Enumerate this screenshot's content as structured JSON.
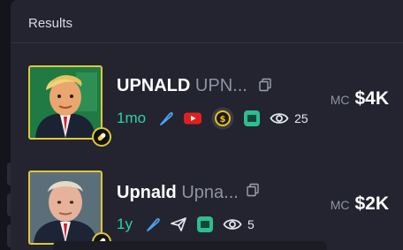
{
  "header": {
    "title": "Results"
  },
  "tokens": [
    {
      "name": "UPNALD",
      "ticker": "UPN...",
      "age": "1mo",
      "views": "25",
      "mc_label": "MC",
      "mc_value": "$4K",
      "icons": [
        "feather-icon",
        "youtube-icon",
        "pump-coin-icon",
        "green-logo-icon",
        "eye-icon"
      ]
    },
    {
      "name": "Upnald",
      "ticker": "Upna...",
      "age": "1y",
      "views": "5",
      "mc_label": "MC",
      "mc_value": "$2K",
      "icons": [
        "feather-icon",
        "send-icon",
        "green-logo-icon",
        "eye-icon"
      ]
    }
  ],
  "colors": {
    "accent_teal": "#2fd0a8",
    "feather_blue": "#4aa3f0",
    "avatar_border": "#e0c63a",
    "youtube_red": "#e02020",
    "muted": "#8f93a3"
  }
}
